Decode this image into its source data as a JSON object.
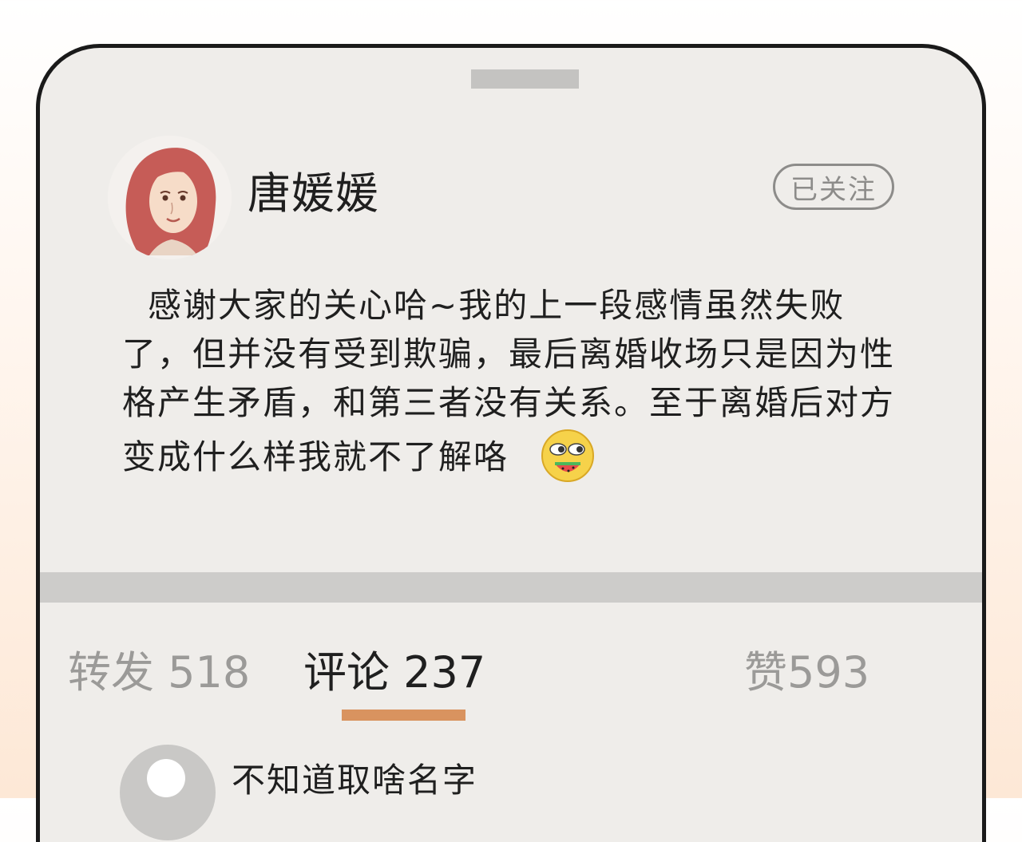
{
  "profile": {
    "username": "唐媛媛",
    "follow_label": "已关注",
    "avatar": "avatar-woman-red-hair"
  },
  "post": {
    "text": "感谢大家的关心哈~我的上一段感情虽然失败了，但并没有受到欺骗，最后离婚收场只是因为性格产生矛盾，和第三者没有关系。至于离婚后对方变成什么样我就不了解咯",
    "emoji": "eating-watermelon-emoji"
  },
  "stats": {
    "repost": "转发 518",
    "comment": "评论 237",
    "like": "赞593",
    "active_tab": "comment"
  },
  "comments": [
    {
      "name": "不知道取啥名字",
      "avatar": "default-avatar"
    }
  ],
  "colors": {
    "card_bg": "#efedea",
    "accent_underline": "#d9935f",
    "muted_text": "#9b9a98",
    "divider": "#cdccca"
  }
}
